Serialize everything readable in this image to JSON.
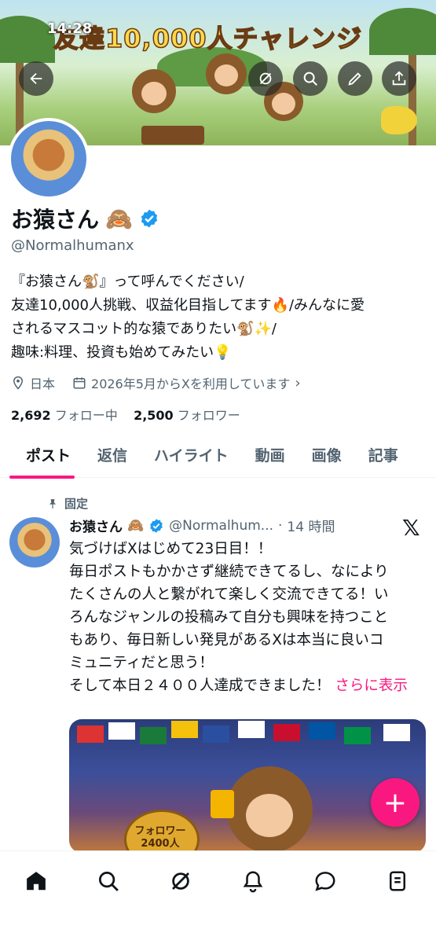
{
  "status": {
    "time": "14:28"
  },
  "banner": {
    "title": "友達10,000人チャレンジ"
  },
  "profile": {
    "name": "お猿さん",
    "name_emoji": "🙈",
    "handle": "@Normalhumanx",
    "bio_lines": [
      "『お猿さん🐒』って呼んでください/",
      "友達10,000人挑戦、収益化目指してます🔥/みんなに愛",
      "されるマスコット的な猿でありたい🐒✨/",
      "趣味:料理、投資も始めてみたい💡"
    ],
    "location": "日本",
    "joined": "2026年5月からXを利用しています",
    "following_count": "2,692",
    "following_label": "フォロー中",
    "followers_count": "2,500",
    "followers_label": "フォロワー"
  },
  "tabs": [
    {
      "label": "ポスト",
      "active": true
    },
    {
      "label": "返信"
    },
    {
      "label": "ハイライト"
    },
    {
      "label": "動画"
    },
    {
      "label": "画像"
    },
    {
      "label": "記事"
    }
  ],
  "tweet": {
    "pinned_label": "固定",
    "author": "お猿さん",
    "author_emoji": "🙈",
    "handle": "@Normalhum...",
    "sep": "·",
    "time": "14 時間",
    "text_lines": [
      "気づけばXはじめて23日目！！",
      "毎日ポストもかかさず継続できてるし、なにより",
      "たくさんの人と繋がれて楽しく交流できてる！い",
      "ろんなジャンルの投稿みて自分も興味を持つこと",
      "もあり、毎日新しい発見があるXは本当に良いコ",
      "ミュニティだと思う！",
      "そして本日２４００人達成できました！"
    ],
    "more_label": "さらに表示",
    "media_badge": "フォロワー 2400人"
  },
  "fab": {
    "label": "+"
  },
  "colors": {
    "accent": "#f91880",
    "verified": "#1d9bf0",
    "muted": "#536471"
  },
  "icons": [
    "back-arrow-icon",
    "grok-icon",
    "search-icon",
    "edit-icon",
    "share-icon",
    "location-icon",
    "calendar-icon",
    "pin-icon",
    "x-logo-icon",
    "home-icon",
    "explore-icon",
    "grok-nav-icon",
    "notifications-icon",
    "messages-icon",
    "lists-icon"
  ]
}
